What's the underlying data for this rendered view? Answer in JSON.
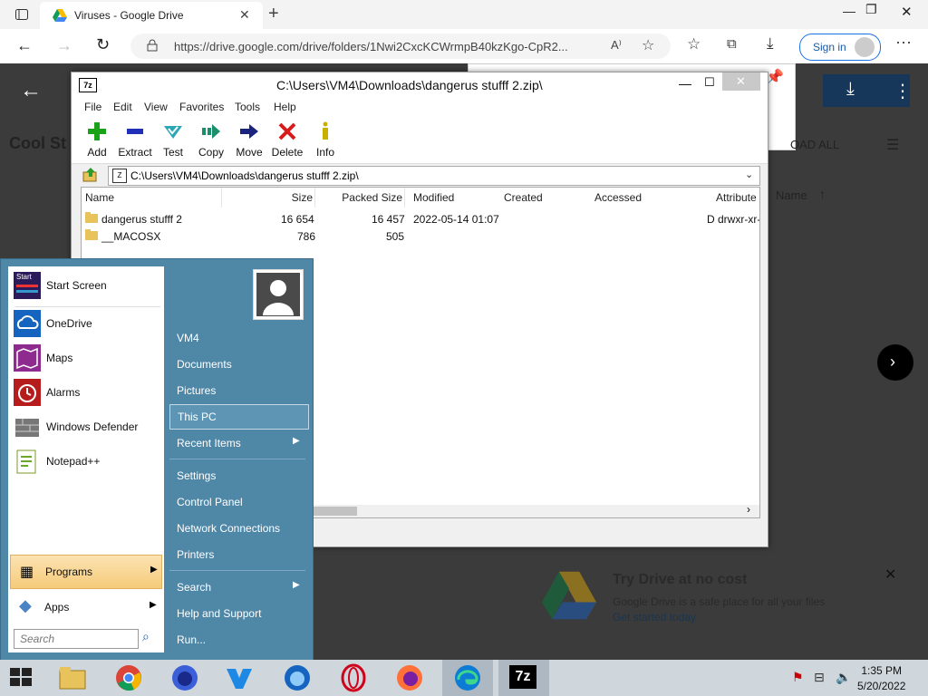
{
  "browser": {
    "tab_title": "Viruses - Google Drive",
    "url": "https://drive.google.com/drive/folders/1Nwi2CxcKCWrmpB40kzKgo-CpR2...",
    "signin_label": "Sign in"
  },
  "drive": {
    "folder_title": "Cool St",
    "download_all": "OAD ALL",
    "name_col": "Name",
    "promo_title": "Try Drive at no cost",
    "promo_sub": "Google Drive is a safe place for all your files",
    "promo_link": "Get started today"
  },
  "zip": {
    "title": "C:\\Users\\VM4\\Downloads\\dangerus stufff 2.zip\\",
    "title_icon": "7z",
    "menu": [
      "File",
      "Edit",
      "View",
      "Favorites",
      "Tools",
      "Help"
    ],
    "toolbar": [
      {
        "label": "Add",
        "icon": "plus-icon",
        "color": "#1aa31a"
      },
      {
        "label": "Extract",
        "icon": "minus-icon",
        "color": "#1f2fb8"
      },
      {
        "label": "Test",
        "icon": "check-down-icon",
        "color": "#2aa7b5"
      },
      {
        "label": "Copy",
        "icon": "copy-arrow-icon",
        "color": "#1a8f6a"
      },
      {
        "label": "Move",
        "icon": "move-arrow-icon",
        "color": "#1a237e"
      },
      {
        "label": "Delete",
        "icon": "delete-x-icon",
        "color": "#d81b1b"
      },
      {
        "label": "Info",
        "icon": "info-icon",
        "color": "#c9b000"
      }
    ],
    "path": "C:\\Users\\VM4\\Downloads\\dangerus stufff 2.zip\\",
    "columns": [
      "Name",
      "Size",
      "Packed Size",
      "Modified",
      "Created",
      "Accessed",
      "Attribute"
    ],
    "rows": [
      {
        "name": "dangerus stufff 2",
        "size": "16 654",
        "packed": "16 457",
        "modified": "2022-05-14 01:07",
        "created": "",
        "accessed": "",
        "attr": "D drwxr-xr-"
      },
      {
        "name": "__MACOSX",
        "size": "786",
        "packed": "505",
        "modified": "",
        "created": "",
        "accessed": "",
        "attr": ""
      }
    ]
  },
  "startmenu": {
    "left_items": [
      {
        "label": "Start Screen",
        "icon": "start-screen-icon"
      },
      {
        "label": "OneDrive",
        "icon": "onedrive-icon"
      },
      {
        "label": "Maps",
        "icon": "maps-icon"
      },
      {
        "label": "Alarms",
        "icon": "alarms-icon"
      },
      {
        "label": "Windows Defender",
        "icon": "windows-defender-icon"
      },
      {
        "label": "Notepad++",
        "icon": "notepadpp-icon"
      }
    ],
    "start_tile_text": "Start",
    "programs_label": "Programs",
    "apps_label": "Apps",
    "search_placeholder": "Search",
    "right_items": [
      {
        "label": "VM4"
      },
      {
        "label": "Documents"
      },
      {
        "label": "Pictures"
      },
      {
        "label": "This PC"
      },
      {
        "label": "Recent Items"
      },
      {
        "label": "Settings"
      },
      {
        "label": "Control Panel"
      },
      {
        "label": "Network Connections"
      },
      {
        "label": "Printers"
      },
      {
        "label": "Search"
      },
      {
        "label": "Help and Support"
      },
      {
        "label": "Run..."
      }
    ]
  },
  "taskbar": {
    "time": "1:35 PM",
    "date": "5/20/2022",
    "sevenzip_label": "7z"
  },
  "colors": {
    "startmenu_bg": "#4f87a7",
    "taskbar_bg": "#cfd6dc",
    "accent": "#1a73e8"
  }
}
